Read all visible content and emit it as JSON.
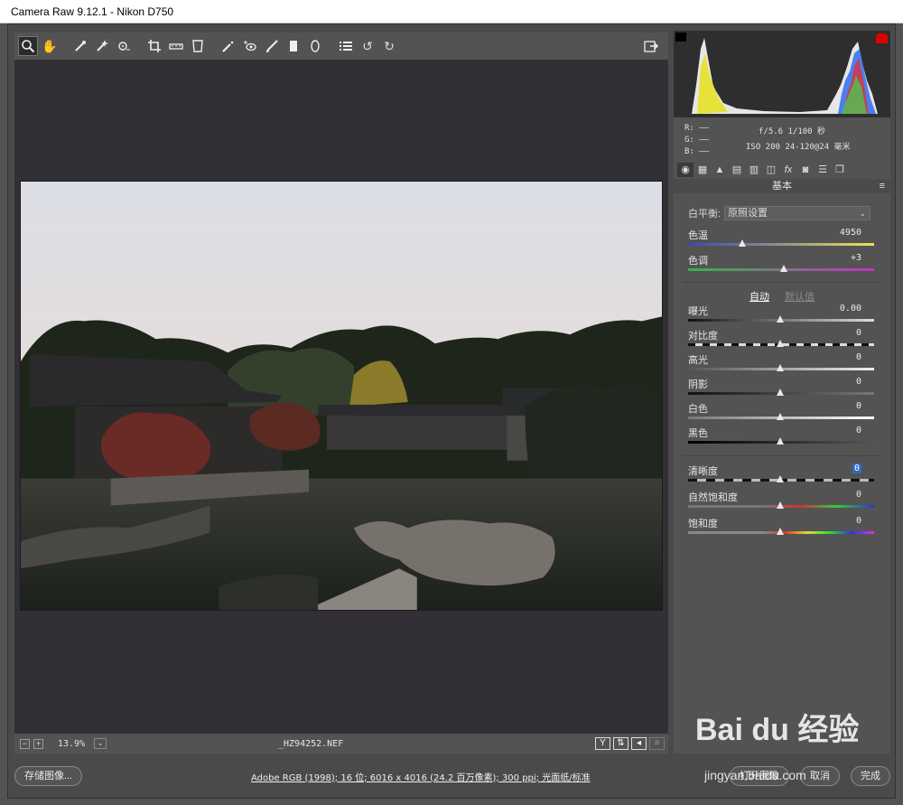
{
  "window": {
    "title": "Camera Raw 9.12.1 -  Nikon D750"
  },
  "toolbar": {
    "tools": [
      "zoom-icon",
      "hand-icon",
      "white-balance-icon",
      "color-sampler-icon",
      "target-adjust-icon",
      "crop-icon",
      "straighten-icon",
      "transform-icon",
      "spot-removal-icon",
      "red-eye-icon",
      "adjustment-brush-icon",
      "graduated-filter-icon",
      "radial-filter-icon",
      "preferences-icon",
      "rotate-ccw-icon",
      "rotate-cw-icon"
    ],
    "fullscreen": "fullscreen-icon"
  },
  "info": {
    "r": "R:  ——",
    "g": "G:  ——",
    "b": "B:  ——",
    "exif_line1": "f/5.6  1/100 秒",
    "exif_line2": "ISO 200   24-120@24 毫米"
  },
  "panel": {
    "title": "基本",
    "tabs": [
      "basic",
      "tone-curve",
      "detail",
      "hsl",
      "split-toning",
      "lens",
      "fx",
      "camera-calibration",
      "presets",
      "snapshots"
    ],
    "white_balance_label": "白平衡:",
    "white_balance_value": "原照设置",
    "auto_label": "自动",
    "default_label": "默认值",
    "sliders": {
      "temp": {
        "label": "色温",
        "value": "4950"
      },
      "tint": {
        "label": "色调",
        "value": "+3"
      },
      "exposure": {
        "label": "曝光",
        "value": "0.00"
      },
      "contrast": {
        "label": "对比度",
        "value": "0"
      },
      "highlights": {
        "label": "高光",
        "value": "0"
      },
      "shadows": {
        "label": "阴影",
        "value": "0"
      },
      "whites": {
        "label": "白色",
        "value": "0"
      },
      "blacks": {
        "label": "黑色",
        "value": "0"
      },
      "clarity": {
        "label": "清晰度",
        "value": "0"
      },
      "vibrance": {
        "label": "自然饱和度",
        "value": "0"
      },
      "saturation": {
        "label": "饱和度",
        "value": "0"
      }
    }
  },
  "status": {
    "zoom": "13.9%",
    "filename": "_HZ94252.NEF"
  },
  "bottom": {
    "save_label": "存储图像...",
    "workflow": "Adobe RGB (1998); 16 位; 6016 x 4016 (24.2 百万像素); 300 ppi; 光面纸/标准",
    "open_label": "打开图像",
    "cancel_label": "取消",
    "done_label": "完成"
  },
  "watermark": {
    "text": "Bai du 经验",
    "sub": "jingyan.baidu.com"
  }
}
